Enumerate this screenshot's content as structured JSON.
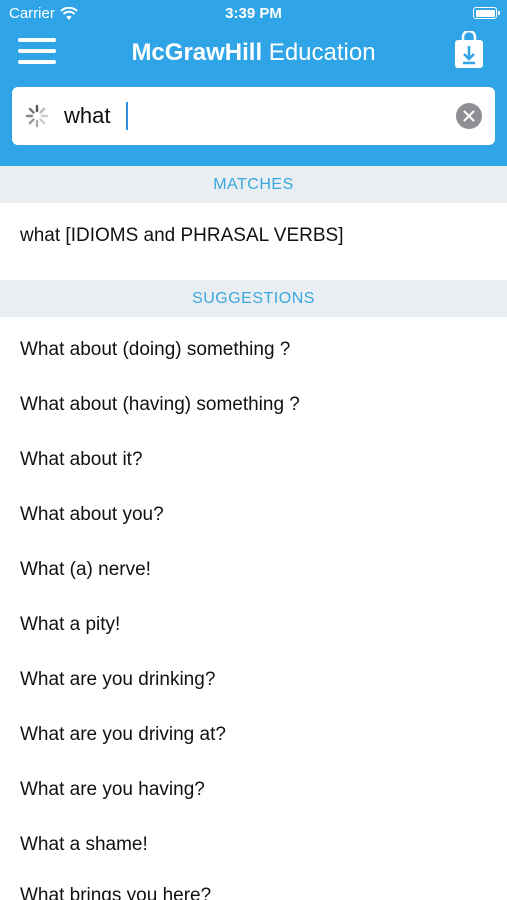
{
  "status_bar": {
    "carrier": "Carrier",
    "time": "3:39 PM"
  },
  "header": {
    "title_bold": "McGrawHill",
    "title_regular": " Education",
    "background_color": "#2fa4e7"
  },
  "search": {
    "value": "what"
  },
  "matches": {
    "header": "MATCHES",
    "items": [
      "what [IDIOMS and PHRASAL VERBS]"
    ]
  },
  "suggestions": {
    "header": "SUGGESTIONS",
    "items": [
      "What about (doing) something ?",
      "What about (having) something ?",
      "What about it?",
      "What about you?",
      "What (a) nerve!",
      "What a pity!",
      "What are you drinking?",
      "What are you driving at?",
      "What are you having?",
      "What a shame!",
      "What brings you here?"
    ]
  },
  "icons": {
    "menu": "hamburger-menu-icon",
    "download": "download-bag-icon",
    "spinner": "loading-spinner-icon",
    "clear": "clear-search-icon",
    "wifi": "wifi-icon",
    "battery": "battery-icon"
  }
}
